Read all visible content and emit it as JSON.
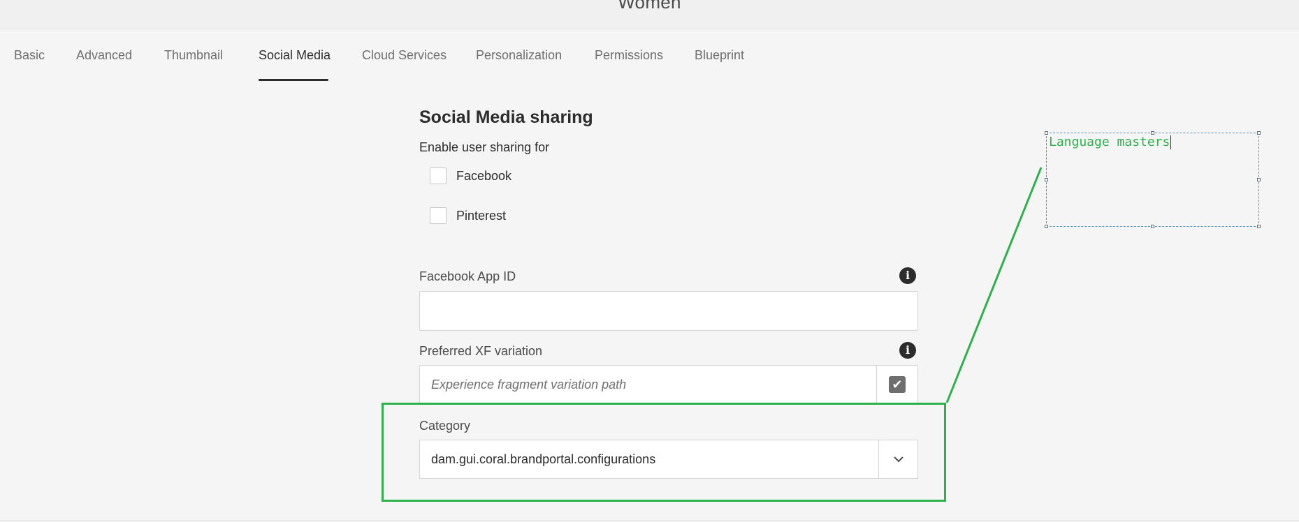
{
  "header": {
    "title": "Women"
  },
  "tabs": [
    {
      "label": "Basic",
      "active": false
    },
    {
      "label": "Advanced",
      "active": false
    },
    {
      "label": "Thumbnail",
      "active": false
    },
    {
      "label": "Social Media",
      "active": true
    },
    {
      "label": "Cloud Services",
      "active": false
    },
    {
      "label": "Personalization",
      "active": false
    },
    {
      "label": "Permissions",
      "active": false
    },
    {
      "label": "Blueprint",
      "active": false
    }
  ],
  "social": {
    "title": "Social Media sharing",
    "subtitle": "Enable user sharing for",
    "checkboxes": [
      {
        "label": "Facebook",
        "checked": false
      },
      {
        "label": "Pinterest",
        "checked": false
      }
    ]
  },
  "facebook_app_id": {
    "label": "Facebook App ID",
    "value": ""
  },
  "xf_variation": {
    "label": "Preferred XF variation",
    "placeholder": "Experience fragment variation path"
  },
  "category": {
    "label": "Category",
    "value": "dam.gui.coral.brandportal.configurations"
  },
  "annotation": {
    "text": "Language masters"
  },
  "colors": {
    "highlight": "#2cb14b",
    "annotation_border": "#4e8fbf"
  }
}
